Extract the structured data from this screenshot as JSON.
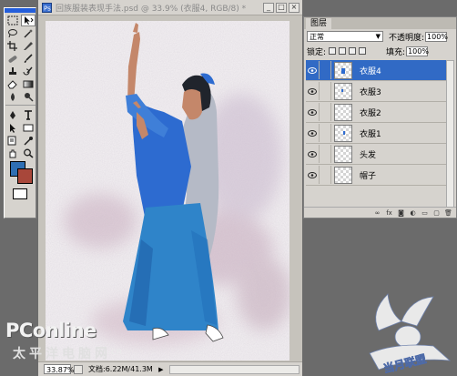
{
  "toolbox": {
    "tools": [
      "marquee-tool",
      "move-tool",
      "lasso-tool",
      "magic-wand-tool",
      "crop-tool",
      "slice-tool",
      "healing-brush-tool",
      "brush-tool",
      "clone-stamp-tool",
      "history-brush-tool",
      "eraser-tool",
      "gradient-tool",
      "blur-tool",
      "dodge-tool",
      "pen-tool",
      "type-tool",
      "path-selection-tool",
      "rectangle-tool",
      "notes-tool",
      "eyedropper-tool",
      "hand-tool",
      "zoom-tool"
    ],
    "foreground_color": "#2f6fb3",
    "background_color": "#a8473a"
  },
  "document": {
    "title": "回族服装表现手法.psd @ 33.9% (衣服4, RGB/8) *",
    "zoom": "33.87%",
    "doc_size": "文档:6.22M/41.3M",
    "colors": {
      "skirt": "#2f84c9",
      "dress": "#2d6bd0",
      "scarf": "#b5bac6",
      "skin": "#c4876a",
      "hair": "#20242c"
    }
  },
  "layers_panel": {
    "tab": "图层",
    "blend_mode": "正常",
    "opacity_label": "不透明度:",
    "opacity_value": "100%",
    "lock_label": "锁定:",
    "fill_label": "填充:",
    "fill_value": "100%",
    "layers": [
      {
        "name": "衣服4",
        "active": true
      },
      {
        "name": "衣服3",
        "active": false
      },
      {
        "name": "衣服2",
        "active": false
      },
      {
        "name": "衣服1",
        "active": false
      },
      {
        "name": "头发",
        "active": false
      },
      {
        "name": "帽子",
        "active": false
      }
    ],
    "bottom_icons": [
      "link-icon",
      "fx-icon",
      "mask-icon",
      "adjustment-icon",
      "folder-icon",
      "new-layer-icon",
      "trash-icon"
    ]
  },
  "watermark": {
    "brand": "PConline",
    "sub": "太平洋电脑网",
    "cn": ".cn",
    "badge": "当月联盟"
  }
}
